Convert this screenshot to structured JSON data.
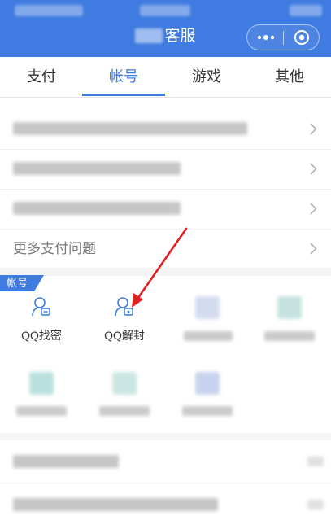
{
  "header": {
    "title": "客服",
    "background": "#3f7be0"
  },
  "tabs": [
    {
      "label": "支付",
      "active": false
    },
    {
      "label": "帐号",
      "active": true
    },
    {
      "label": "游戏",
      "active": false
    },
    {
      "label": "其他",
      "active": false
    }
  ],
  "list": {
    "more_payment": "更多支付问题"
  },
  "section": {
    "tag": "帐号",
    "items": [
      {
        "label": "QQ找密",
        "icon": "user-lock-icon"
      },
      {
        "label": "QQ解封",
        "icon": "user-unlock-icon"
      }
    ]
  },
  "colors": {
    "accent": "#3f7be0",
    "annotation_arrow": "#e02020"
  }
}
